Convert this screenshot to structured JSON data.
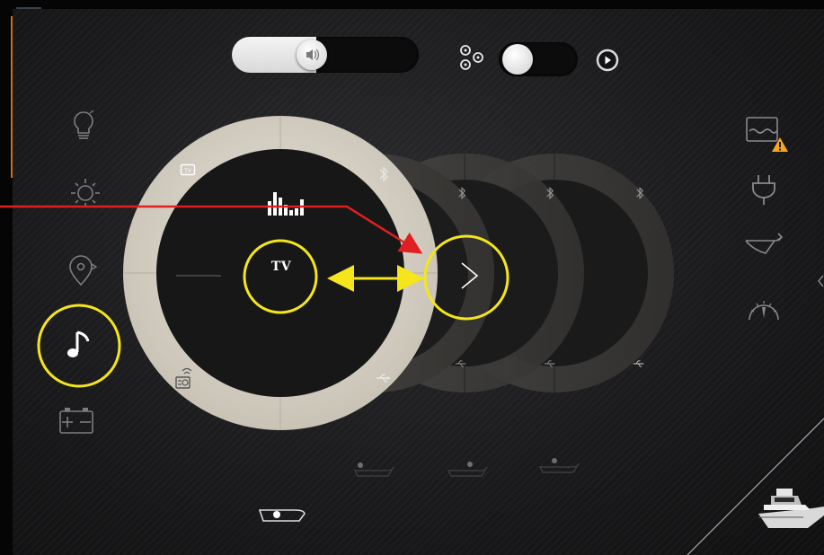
{
  "volume": {
    "level": 0.45,
    "icon": "speaker-icon"
  },
  "source_toggle": {
    "state": "on",
    "left_icon": "multi-speaker-icon",
    "right_icon": "play-icon"
  },
  "left_sidebar": [
    {
      "name": "lighting-icon"
    },
    {
      "name": "climate-icon"
    },
    {
      "name": "navigation-icon"
    },
    {
      "name": "music-icon",
      "active": true
    },
    {
      "name": "battery-icon"
    }
  ],
  "right_sidebar": [
    {
      "name": "tank-level-icon",
      "warning": true
    },
    {
      "name": "shore-power-icon"
    },
    {
      "name": "windlass-icon"
    },
    {
      "name": "gauge-icon"
    }
  ],
  "wheel": {
    "active": {
      "center_label": "TV",
      "tl_icon": "tv-small-icon",
      "tr_icon": "bluetooth-icon",
      "bl_icon": "radio-icon",
      "br_icon": "usb-icon",
      "top_icon": "equalizer-icon"
    },
    "ghost_count": 3,
    "next_icon": "chevron-right-icon"
  },
  "zones": [
    "boat-zone-stern-icon",
    "boat-zone-mid-icon",
    "boat-zone-bow-icon"
  ],
  "home_zone_icon": "boat-zone-active-icon",
  "colors": {
    "ring": "#d8d3c8",
    "ring_ghost": "#3a3937",
    "accent": "#ffffff",
    "annotation_yellow": "#f5e51c",
    "annotation_red": "#e02020",
    "warning": "#f5a623",
    "chrome_orange": "#d06a1c"
  }
}
